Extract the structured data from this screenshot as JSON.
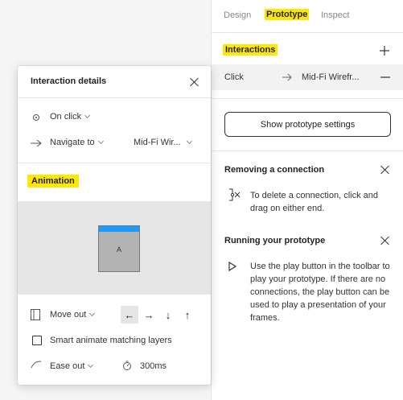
{
  "tabs": {
    "design": "Design",
    "prototype": "Prototype",
    "inspect": "Inspect"
  },
  "interactions": {
    "title": "Interactions",
    "add_icon": "plus-icon",
    "row": {
      "trigger": "Click",
      "target": "Mid-Fi Wirefr...",
      "arrow_icon": "arrow-right-icon",
      "remove_icon": "minus-icon"
    }
  },
  "settings_button": "Show prototype settings",
  "removing": {
    "title": "Removing a connection",
    "text": "To delete a connection, click and drag on either end."
  },
  "running": {
    "title": "Running your prototype",
    "text": "Use the play button in the toolbar to play your prototype. If there are no connections, the play button can be used to play a presentation of your frames."
  },
  "popup": {
    "title": "Interaction details",
    "trigger": "On click",
    "action": "Navigate to",
    "destination": "Mid-Fi Wir...",
    "animation_label": "Animation",
    "frame_letter": "A",
    "transition": "Move out",
    "directions": [
      "←",
      "→",
      "↓",
      "↑"
    ],
    "selected_direction": "←",
    "smart_animate": "Smart animate matching layers",
    "smart_animate_checked": false,
    "easing": "Ease out",
    "duration": "300ms"
  },
  "colors": {
    "highlight": "#ffe800",
    "frame_bar": "#1c9bff"
  }
}
